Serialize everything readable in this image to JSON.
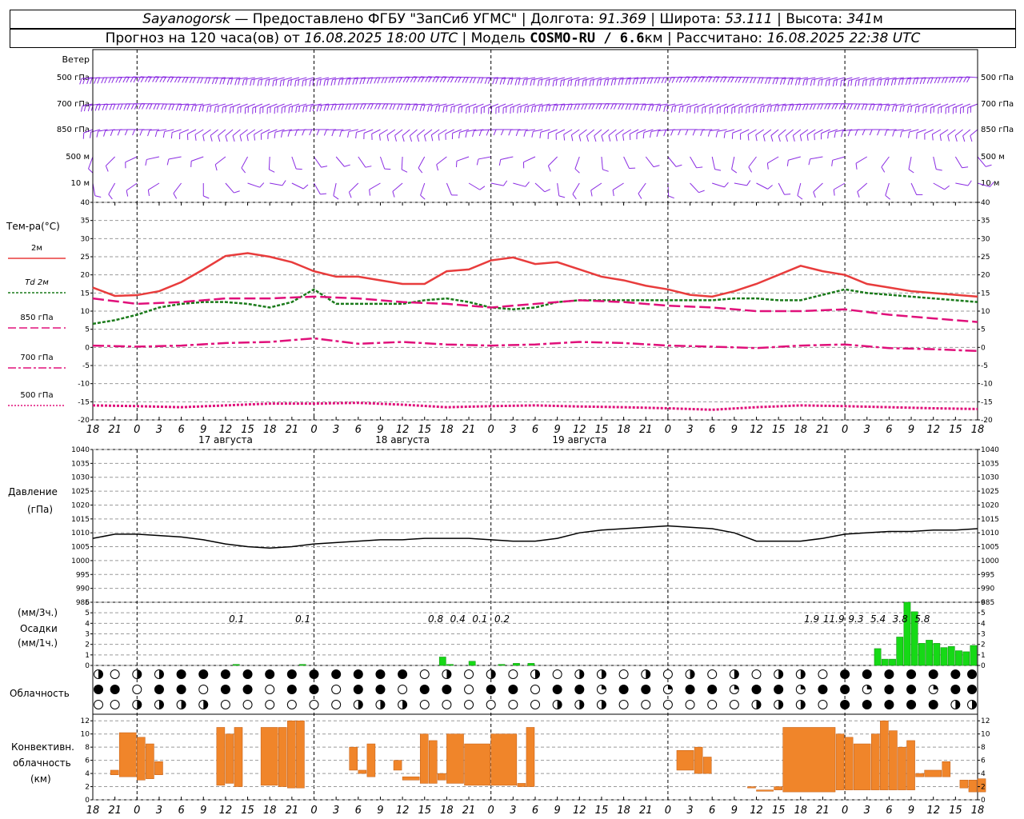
{
  "header": {
    "station": "Sayanogorsk",
    "provider": " — Предоставлено ФГБУ \"ЗапСиб УГМС\" | Долгота: ",
    "lon": "91.369",
    "lat_label": " | Широта: ",
    "lat": "53.111",
    "alt_label": " | Высота: ",
    "alt": "341",
    "alt_unit": "м",
    "forecast_prefix": "Прогноз на 120 часа(ов) от ",
    "forecast_time": "16.08.2025 18:00 UTC",
    "model_label": " | Модель ",
    "model": "COSMO-RU / 6.6",
    "model_unit": "км",
    "calc_label": " | Рассчитано: ",
    "calc_time": "16.08.2025 22:38 UTC"
  },
  "labels": {
    "wind": "Ветер",
    "wind_levels": [
      "500 гПа",
      "700 гПа",
      "850 гПа",
      "500 м",
      "10 м"
    ],
    "temp_title": "Тем-ра(°C)",
    "temp_legend": [
      "2м",
      "Td  2м",
      "850 гПа",
      "700 гПа",
      "500 гПа"
    ],
    "pressure_title": "Давление",
    "pressure_unit": "(гПа)",
    "precip_3h": "(мм/3ч.)",
    "precip_title": "Осадки",
    "precip_1h": "(мм/1ч.)",
    "cloud_title": "Облачность",
    "conv_title": [
      "Конвективн.",
      "облачность",
      "(км)"
    ],
    "dates": [
      "17 августа",
      "18 августа",
      "19 августа"
    ]
  },
  "colors": {
    "wind": "#8a2be2",
    "t2m": "#e83c3c",
    "td2m": "#1a7a1a",
    "t850": "#e0107a",
    "t700": "#e0107a",
    "t500": "#e0107a",
    "precip": "#16d916",
    "conv": "#f0852a",
    "pressure": "#000000"
  },
  "chart_data": [
    {
      "type": "line",
      "title": "Тем-ра(°C)",
      "x_hours_tick_labels": [
        "18",
        "21",
        "0",
        "3",
        "6",
        "9",
        "12",
        "15",
        "18",
        "21",
        "0",
        "3",
        "6",
        "9",
        "12",
        "15",
        "18",
        "21",
        "0",
        "3",
        "6",
        "9",
        "12",
        "15",
        "18",
        "21",
        "0"
      ],
      "ylim": [
        -20,
        40
      ],
      "series": [
        {
          "name": "2м",
          "x": [
            0,
            3,
            6,
            9,
            12,
            15,
            18,
            21,
            24,
            27,
            30,
            33,
            36,
            39,
            42,
            45,
            48,
            51,
            54,
            57,
            60,
            63,
            66,
            69,
            72,
            75,
            78,
            81,
            84,
            87,
            90,
            93,
            96,
            99,
            102,
            105,
            108,
            111,
            114,
            117,
            120
          ],
          "values": [
            16.5,
            14.2,
            14.4,
            15.5,
            18.0,
            21.5,
            25.2,
            26.0,
            25.0,
            23.5,
            21.0,
            19.5,
            19.5,
            18.5,
            17.5,
            17.5,
            21.0,
            21.5,
            24.0,
            24.8,
            23.0,
            23.5,
            21.5,
            19.5,
            18.5,
            17.0,
            16.0,
            14.5,
            14.0,
            15.5,
            17.5,
            20.0,
            22.5,
            21.0,
            20.0,
            17.5,
            16.5,
            15.5,
            15.0,
            14.5,
            14.0
          ]
        },
        {
          "name": "Td  2м",
          "x": [
            0,
            3,
            6,
            9,
            12,
            15,
            18,
            21,
            24,
            27,
            30,
            33,
            36,
            39,
            42,
            45,
            48,
            51,
            54,
            57,
            60,
            63,
            66,
            69,
            72,
            75,
            78,
            81,
            84,
            87,
            90,
            93,
            96,
            99,
            102,
            105,
            108,
            111,
            114,
            117,
            120
          ],
          "values": [
            6.5,
            7.5,
            9.0,
            11.0,
            12.0,
            12.5,
            12.5,
            12.0,
            11.0,
            12.5,
            16.0,
            12.0,
            12.0,
            12.0,
            12.0,
            13.0,
            13.5,
            12.5,
            11.0,
            10.5,
            11.0,
            12.5,
            13.0,
            13.0,
            13.0,
            13.0,
            13.0,
            13.0,
            13.0,
            13.5,
            13.5,
            13.0,
            13.0,
            14.5,
            16.0,
            15.0,
            14.5,
            14.0,
            13.5,
            13.0,
            12.5
          ]
        },
        {
          "name": "850 гПа",
          "x": [
            0,
            6,
            12,
            18,
            24,
            30,
            36,
            42,
            48,
            54,
            60,
            66,
            72,
            78,
            84,
            90,
            96,
            102,
            108,
            114,
            120
          ],
          "values": [
            13.5,
            12.0,
            12.5,
            13.5,
            13.5,
            14.0,
            13.5,
            12.5,
            12.0,
            11.0,
            12.0,
            13.0,
            12.5,
            11.5,
            11.0,
            10.0,
            10.0,
            10.5,
            9.0,
            8.0,
            7.0
          ]
        },
        {
          "name": "700 гПа",
          "x": [
            0,
            6,
            12,
            18,
            24,
            30,
            36,
            42,
            48,
            54,
            60,
            66,
            72,
            78,
            84,
            90,
            96,
            102,
            108,
            114,
            120
          ],
          "values": [
            0.5,
            0.2,
            0.5,
            1.2,
            1.5,
            2.5,
            1.0,
            1.5,
            0.8,
            0.5,
            0.8,
            1.5,
            1.2,
            0.5,
            0.2,
            -0.2,
            0.5,
            0.8,
            -0.2,
            -0.5,
            -1.0
          ]
        },
        {
          "name": "500 гПа",
          "x": [
            0,
            6,
            12,
            18,
            24,
            30,
            36,
            42,
            48,
            54,
            60,
            66,
            72,
            78,
            84,
            90,
            96,
            102,
            108,
            114,
            120
          ],
          "values": [
            -16.0,
            -16.2,
            -16.5,
            -16.0,
            -15.5,
            -15.5,
            -15.3,
            -15.8,
            -16.5,
            -16.2,
            -16.0,
            -16.3,
            -16.5,
            -16.8,
            -17.2,
            -16.5,
            -16.0,
            -16.2,
            -16.5,
            -16.8,
            -17.0
          ]
        }
      ]
    },
    {
      "type": "line",
      "title": "Давление",
      "ylim": [
        985,
        1040
      ],
      "series": [
        {
          "name": "",
          "x": [
            0,
            3,
            6,
            9,
            12,
            15,
            18,
            21,
            24,
            27,
            30,
            33,
            36,
            39,
            42,
            45,
            48,
            51,
            54,
            57,
            60,
            63,
            66,
            69,
            72,
            75,
            78,
            81,
            84,
            87,
            90,
            93,
            96,
            99,
            102,
            105,
            108,
            111,
            114,
            117,
            120
          ],
          "values": [
            1008,
            1009.5,
            1009.5,
            1009,
            1008.5,
            1007.5,
            1006,
            1005,
            1004.5,
            1005,
            1006,
            1006.5,
            1007,
            1007.5,
            1007.5,
            1008,
            1008,
            1008,
            1007.5,
            1007,
            1007,
            1008,
            1010,
            1011,
            1011.5,
            1012,
            1012.5,
            1012,
            1011.5,
            1010,
            1007,
            1007,
            1007,
            1008,
            1009.5,
            1010,
            1010.5,
            1010.5,
            1011,
            1011,
            1011.5
          ]
        }
      ]
    },
    {
      "type": "bar",
      "title": "Осадки",
      "ylim": [
        0,
        6
      ],
      "x_hours": [
        20,
        29,
        48,
        49,
        52,
        56,
        58,
        60,
        107,
        108,
        109,
        110,
        111,
        112,
        113,
        114,
        115,
        116,
        117,
        118,
        119,
        120
      ],
      "values": [
        0.1,
        0.1,
        0.8,
        0.1,
        0.4,
        0.1,
        0.2,
        0.2,
        1.6,
        0.6,
        0.6,
        2.7,
        6.0,
        5.1,
        2.1,
        2.4,
        2.1,
        1.7,
        1.8,
        1.4,
        1.3,
        1.9
      ],
      "labels_3h": [
        {
          "x": 21,
          "text": "0.1"
        },
        {
          "x": 30,
          "text": "0.1"
        },
        {
          "x": 48,
          "text": "0.8"
        },
        {
          "x": 51,
          "text": "0.4"
        },
        {
          "x": 54,
          "text": "0.1"
        },
        {
          "x": 57,
          "text": "0.2"
        },
        {
          "x": 99,
          "text": "1.9"
        },
        {
          "x": 102,
          "text": "11.9"
        },
        {
          "x": 105,
          "text": "9.3"
        },
        {
          "x": 108,
          "text": "5.4"
        },
        {
          "x": 111,
          "text": "3.8"
        },
        {
          "x": 114,
          "text": "5.8"
        }
      ]
    },
    {
      "type": "bar",
      "title": "Конвективн. облачность (км)",
      "ylim": [
        0,
        13
      ],
      "bars": [
        {
          "x0": 2,
          "x1": 3,
          "base": 3.8,
          "top": 4.5
        },
        {
          "x0": 3,
          "x1": 5,
          "base": 3.5,
          "top": 10.2
        },
        {
          "x0": 5,
          "x1": 6,
          "base": 3.0,
          "top": 9.5
        },
        {
          "x0": 6,
          "x1": 7,
          "base": 3.2,
          "top": 8.5
        },
        {
          "x0": 7,
          "x1": 8,
          "base": 3.8,
          "top": 5.8
        },
        {
          "x0": 14,
          "x1": 15,
          "base": 2.2,
          "top": 11.0
        },
        {
          "x0": 15,
          "x1": 16,
          "base": 2.5,
          "top": 10.0
        },
        {
          "x0": 16,
          "x1": 17,
          "base": 2.0,
          "top": 11.0
        },
        {
          "x0": 19,
          "x1": 21,
          "base": 2.2,
          "top": 11.0
        },
        {
          "x0": 21,
          "x1": 22,
          "base": 2.0,
          "top": 11.0
        },
        {
          "x0": 22,
          "x1": 23,
          "base": 1.8,
          "top": 12.0
        },
        {
          "x0": 23,
          "x1": 24,
          "base": 1.8,
          "top": 12.0
        },
        {
          "x0": 29,
          "x1": 30,
          "base": 4.5,
          "top": 8.0
        },
        {
          "x0": 30,
          "x1": 31,
          "base": 4.0,
          "top": 4.5
        },
        {
          "x0": 31,
          "x1": 32,
          "base": 3.5,
          "top": 8.5
        },
        {
          "x0": 34,
          "x1": 35,
          "base": 4.5,
          "top": 6.0
        },
        {
          "x0": 35,
          "x1": 37,
          "base": 3.0,
          "top": 3.5
        },
        {
          "x0": 37,
          "x1": 38,
          "base": 2.5,
          "top": 10.0
        },
        {
          "x0": 38,
          "x1": 39,
          "base": 2.5,
          "top": 9.0
        },
        {
          "x0": 39,
          "x1": 40,
          "base": 3.0,
          "top": 4.0
        },
        {
          "x0": 40,
          "x1": 42,
          "base": 2.5,
          "top": 10.0
        },
        {
          "x0": 42,
          "x1": 45,
          "base": 2.2,
          "top": 8.5
        },
        {
          "x0": 45,
          "x1": 48,
          "base": 2.2,
          "top": 10.0
        },
        {
          "x0": 48,
          "x1": 49,
          "base": 2.0,
          "top": 2.5
        },
        {
          "x0": 49,
          "x1": 50,
          "base": 2.0,
          "top": 11.0
        },
        {
          "x0": 66,
          "x1": 68,
          "base": 4.5,
          "top": 7.5
        },
        {
          "x0": 68,
          "x1": 69,
          "base": 4.0,
          "top": 8.0
        },
        {
          "x0": 69,
          "x1": 70,
          "base": 4.0,
          "top": 6.5
        },
        {
          "x0": 74,
          "x1": 75,
          "base": 1.8,
          "top": 2.0
        },
        {
          "x0": 75,
          "x1": 77,
          "base": 1.3,
          "top": 1.5
        },
        {
          "x0": 77,
          "x1": 78,
          "base": 1.5,
          "top": 2.0
        },
        {
          "x0": 78,
          "x1": 84,
          "base": 1.2,
          "top": 11.0
        },
        {
          "x0": 84,
          "x1": 85,
          "base": 1.5,
          "top": 10.0
        },
        {
          "x0": 85,
          "x1": 86,
          "base": 1.5,
          "top": 9.5
        },
        {
          "x0": 86,
          "x1": 88,
          "base": 1.5,
          "top": 8.5
        },
        {
          "x0": 88,
          "x1": 89,
          "base": 1.5,
          "top": 10.0
        },
        {
          "x0": 89,
          "x1": 90,
          "base": 1.5,
          "top": 12.0
        },
        {
          "x0": 90,
          "x1": 91,
          "base": 1.5,
          "top": 10.5
        },
        {
          "x0": 91,
          "x1": 92,
          "base": 1.5,
          "top": 8.0
        },
        {
          "x0": 92,
          "x1": 93,
          "base": 1.5,
          "top": 9.0
        },
        {
          "x0": 93,
          "x1": 94,
          "base": 3.5,
          "top": 4.0
        },
        {
          "x0": 94,
          "x1": 96,
          "base": 3.5,
          "top": 4.5
        },
        {
          "x0": 96,
          "x1": 97,
          "base": 3.5,
          "top": 5.8
        },
        {
          "x0": 98,
          "x1": 99,
          "base": 1.8,
          "top": 3.0
        },
        {
          "x0": 99,
          "x1": 100,
          "base": 1.2,
          "top": 3.0
        },
        {
          "x0": 100,
          "x1": 101,
          "base": 1.2,
          "top": 3.2
        }
      ]
    }
  ]
}
